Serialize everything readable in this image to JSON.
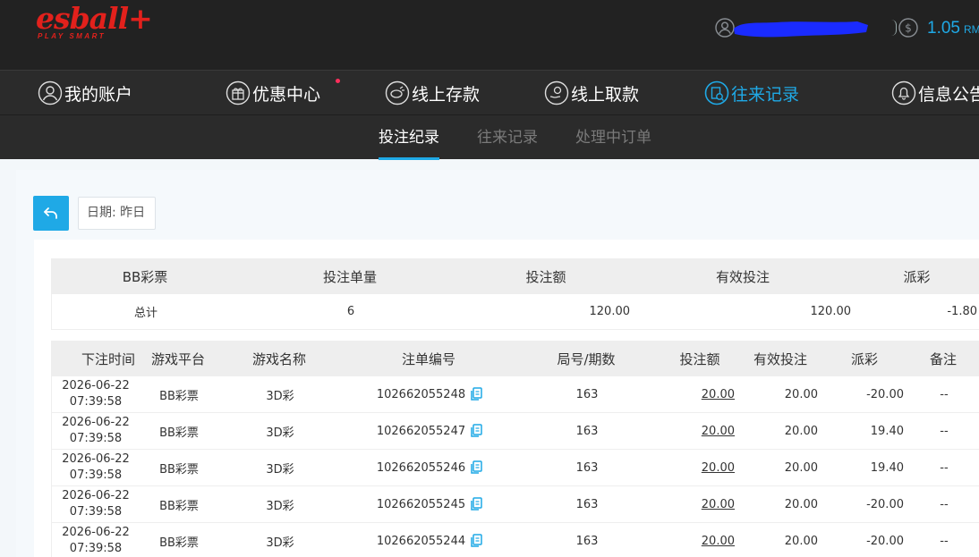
{
  "header": {
    "logo_main": "esball+",
    "logo_sub": "PLAY SMART",
    "balance": "1.05",
    "currency": "RMB"
  },
  "nav": {
    "items": [
      {
        "label": "我的账户",
        "icon": "user-icon"
      },
      {
        "label": "优惠中心",
        "icon": "gift-icon"
      },
      {
        "label": "线上存款",
        "icon": "deposit-icon"
      },
      {
        "label": "线上取款",
        "icon": "withdraw-icon"
      },
      {
        "label": "往来记录",
        "icon": "records-icon"
      },
      {
        "label": "信息公告",
        "icon": "bell-icon"
      }
    ],
    "active_index": 4
  },
  "subtabs": [
    {
      "label": "投注纪录"
    },
    {
      "label": "往来记录"
    },
    {
      "label": "处理中订单"
    }
  ],
  "filter": {
    "date_label": "日期: 昨日"
  },
  "summary": {
    "headers": [
      "BB彩票",
      "投注单量",
      "投注额",
      "有效投注",
      "派彩"
    ],
    "row": [
      "总计",
      "6",
      "120.00",
      "120.00",
      "-1.80"
    ]
  },
  "detail": {
    "headers": [
      "下注时间",
      "游戏平台",
      "游戏名称",
      "注单编号",
      "局号/期数",
      "投注额",
      "有效投注",
      "派彩",
      "备注"
    ],
    "rows": [
      {
        "date": "2026-06-22",
        "time": "07:39:58",
        "platform": "BB彩票",
        "game": "3D彩",
        "order_no": "102662055248",
        "round": "163",
        "bet": "20.00",
        "valid": "20.00",
        "payout": "-20.00",
        "note": "--"
      },
      {
        "date": "2026-06-22",
        "time": "07:39:58",
        "platform": "BB彩票",
        "game": "3D彩",
        "order_no": "102662055247",
        "round": "163",
        "bet": "20.00",
        "valid": "20.00",
        "payout": "19.40",
        "note": "--"
      },
      {
        "date": "2026-06-22",
        "time": "07:39:58",
        "platform": "BB彩票",
        "game": "3D彩",
        "order_no": "102662055246",
        "round": "163",
        "bet": "20.00",
        "valid": "20.00",
        "payout": "19.40",
        "note": "--"
      },
      {
        "date": "2026-06-22",
        "time": "07:39:58",
        "platform": "BB彩票",
        "game": "3D彩",
        "order_no": "102662055245",
        "round": "163",
        "bet": "20.00",
        "valid": "20.00",
        "payout": "-20.00",
        "note": "--"
      },
      {
        "date": "2026-06-22",
        "time": "07:39:58",
        "platform": "BB彩票",
        "game": "3D彩",
        "order_no": "102662055244",
        "round": "163",
        "bet": "20.00",
        "valid": "20.00",
        "payout": "-20.00",
        "note": "--"
      }
    ]
  },
  "colors": {
    "accent": "#1fa9e6",
    "negative": "#e3486f",
    "brand": "#e2211c"
  }
}
